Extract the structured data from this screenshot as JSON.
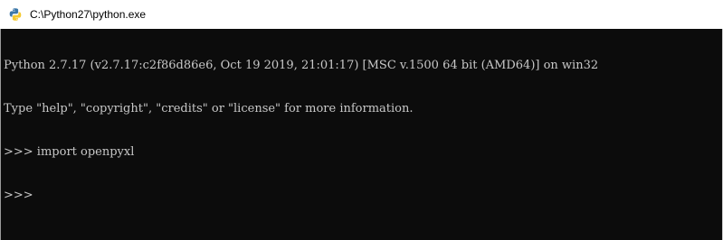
{
  "window": {
    "title": "C:\\Python27\\python.exe",
    "icon": "python-icon"
  },
  "console": {
    "lines": [
      "Python 2.7.17 (v2.7.17:c2f86d86e6, Oct 19 2019, 21:01:17) [MSC v.1500 64 bit (AMD64)] on win32",
      "Type \"help\", \"copyright\", \"credits\" or \"license\" for more information.",
      ">>> import openpyxl",
      ">>> "
    ],
    "colors": {
      "background": "#0c0c0c",
      "text": "#c8c8c8"
    }
  }
}
